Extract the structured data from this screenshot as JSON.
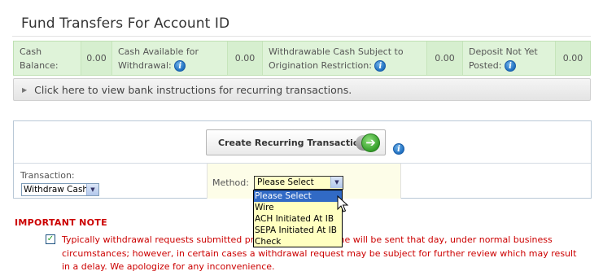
{
  "page": {
    "title": "Fund Transfers For Account ID"
  },
  "balances": {
    "cash_balance_label_1": "Cash",
    "cash_balance_label_2": "Balance:",
    "cash_balance_value": "0.00",
    "cash_available_label_1": "Cash Available for",
    "cash_available_label_2": "Withdrawal:",
    "cash_available_value": "0.00",
    "withdrawable_label_1": "Withdrawable Cash Subject to",
    "withdrawable_label_2": "Origination Restriction:",
    "withdrawable_value": "0.00",
    "deposit_label_1": "Deposit Not Yet",
    "deposit_label_2": "Posted:",
    "deposit_value": "0.00",
    "info_glyph": "i"
  },
  "instructions": {
    "label": "Click here to view bank instructions for recurring transactions."
  },
  "panel": {
    "create_button_label": "Create Recurring Transaction",
    "go_glyph": "➔",
    "transaction_label": "Transaction:",
    "transaction_value": "Withdraw Cash",
    "method_label": "Method:",
    "method_value": "Please Select",
    "select_arrow": "▼"
  },
  "method_options": [
    "Please Select",
    "Wire",
    "ACH Initiated At IB",
    "SEPA Initiated At IB",
    "Check"
  ],
  "note": {
    "heading": "IMPORTANT NOTE",
    "check_glyph": "✓",
    "text": "Typically withdrawal requests submitted prior to the cut-off time will be sent that day, under normal business circumstances; however, in certain cases a withdrawal request may be subject for further review which may result in a delay. We apologize for any inconvenience."
  },
  "colors": {
    "balances_bg": "#dff3d9",
    "accent_red": "#cc0000",
    "dropdown_bg": "#ffffc0",
    "dropdown_selected": "#316ac5"
  }
}
